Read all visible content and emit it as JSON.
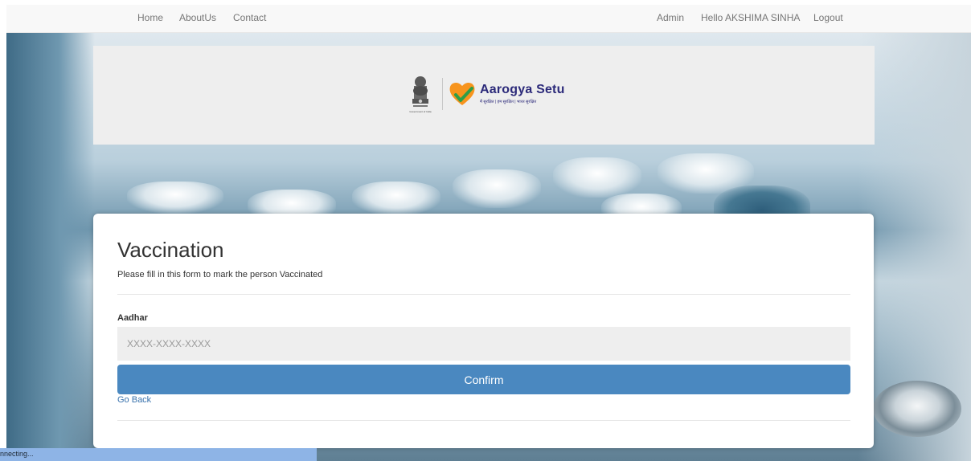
{
  "navbar": {
    "left": [
      "Home",
      "AboutUs",
      "Contact"
    ],
    "right": [
      "Admin",
      "Hello AKSHIMA SINHA",
      "Logout"
    ]
  },
  "banner": {
    "emblem_caption": "Government of India",
    "brand_name": "Aarogya Setu",
    "brand_tagline": "मैं सुरक्षित | हम सुरक्षित | भारत सुरक्षित",
    "heart_color": "#f7941d",
    "check_color": "#2e9e48",
    "brand_color": "#2c2a7a"
  },
  "form": {
    "title": "Vaccination",
    "subtitle": "Please fill in this form to mark the person Vaccinated",
    "aadhar_label": "Aadhar",
    "aadhar_placeholder": "XXXX-XXXX-XXXX",
    "aadhar_value": "",
    "confirm_label": "Confirm",
    "go_back_label": "Go Back",
    "button_color": "#4a88c0"
  },
  "status": {
    "text": "nnecting..."
  }
}
